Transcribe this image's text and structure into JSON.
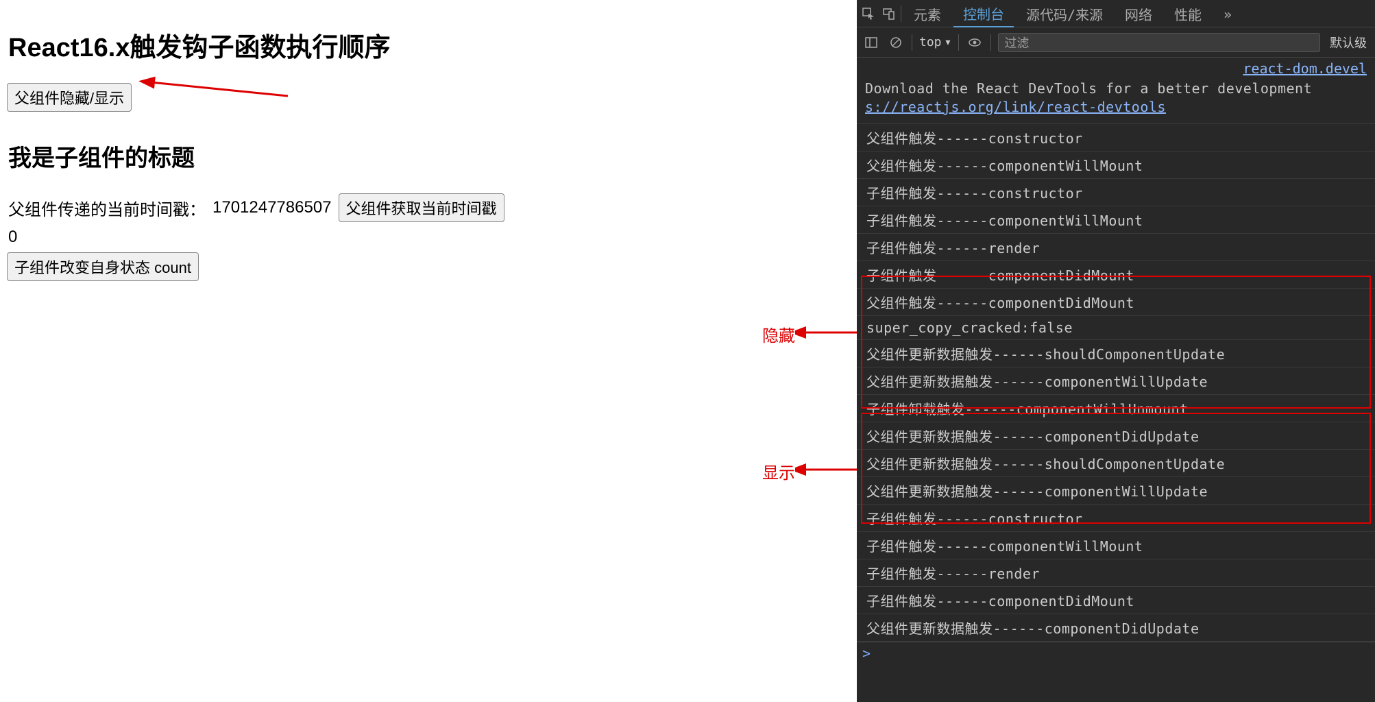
{
  "page": {
    "title": "React16.x触发钩子函数执行顺序",
    "toggle_button": "父组件隐藏/显示",
    "child_title": "我是子组件的标题",
    "timestamp_label": "父组件传递的当前时间戳：",
    "timestamp_value": "1701247786507",
    "get_timestamp_button": "父组件获取当前时间戳",
    "count_value": "0",
    "change_count_button": "子组件改变自身状态 count"
  },
  "annotations": {
    "hide_label": "隐藏",
    "show_label": "显示"
  },
  "devtools": {
    "tabs": {
      "inspect_icon": "⌕",
      "elements": "元素",
      "console": "控制台",
      "sources": "源代码/来源",
      "network": "网络",
      "performance": "性能",
      "overflow": "»"
    },
    "toolbar": {
      "sidebar_icon": "☰",
      "clear_icon": "⊘",
      "context": "top",
      "dropdown_icon": "▾",
      "eye_icon": "◉",
      "filter_placeholder": "过滤",
      "level_label": "默认级"
    },
    "source_link": "react-dom.devel",
    "download_msg_before": "Download the React DevTools for a better development ",
    "download_link_text": "s://reactjs.org/link/react-devtools",
    "logs": [
      "父组件触发------constructor",
      "父组件触发------componentWillMount",
      "子组件触发------constructor",
      "子组件触发------componentWillMount",
      "子组件触发------render",
      "子组件触发------componentDidMount",
      "父组件触发------componentDidMount",
      "super_copy_cracked:false",
      "父组件更新数据触发------shouldComponentUpdate",
      "父组件更新数据触发------componentWillUpdate",
      "子组件卸载触发------componentWillUnmount",
      "父组件更新数据触发------componentDidUpdate",
      "父组件更新数据触发------shouldComponentUpdate",
      "父组件更新数据触发------componentWillUpdate",
      "子组件触发------constructor",
      "子组件触发------componentWillMount",
      "子组件触发------render",
      "子组件触发------componentDidMount",
      "父组件更新数据触发------componentDidUpdate"
    ],
    "prompt": ">"
  }
}
